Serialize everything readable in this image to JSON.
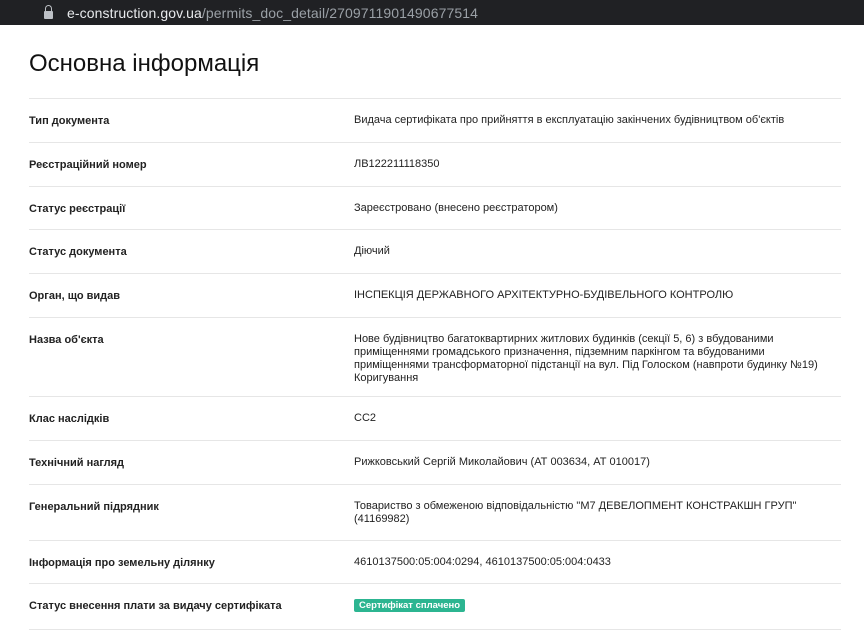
{
  "browser": {
    "url_host": "e-construction.gov.ua",
    "url_path": "/permits_doc_detail/2709711901490677514"
  },
  "page": {
    "title": "Основна інформація",
    "rows": [
      {
        "label": "Тип документа",
        "value": "Видача сертифіката про прийняття в експлуатацію закінчених будівництвом об'єктів"
      },
      {
        "label": "Реєстраційний номер",
        "value": "ЛВ122211118350"
      },
      {
        "label": "Статус реєстрації",
        "value": "Зареєстровано (внесено реєстратором)"
      },
      {
        "label": "Статус документа",
        "value": "Діючий"
      },
      {
        "label": "Орган, що видав",
        "value": "ІНСПЕКЦІЯ ДЕРЖАВНОГО АРХІТЕКТУРНО-БУДІВЕЛЬНОГО КОНТРОЛЮ"
      },
      {
        "label": "Назва об'єкта",
        "value": "Нове будівництво багатоквартирних житлових будинків (секції 5, 6) з вбудованими приміщеннями громадського призначення, підземним паркінгом та вбудованими приміщеннями трансформаторної підстанції на вул. Під Голоском (навпроти будинку №19) Коригування"
      },
      {
        "label": "Клас наслідків",
        "value": "СС2"
      },
      {
        "label": "Технічний нагляд",
        "value": "Рижковський Сергій Миколайович (АТ 003634, АТ 010017)"
      },
      {
        "label": "Генеральний підрядник",
        "value": "Товариство з обмеженою відповідальністю \"М7 ДЕВЕЛОПМЕНТ КОНСТРАКШН ГРУП\" (41169982)"
      },
      {
        "label": "Інформація про земельну ділянку",
        "value": "4610137500:05:004:0294, 4610137500:05:004:0433"
      },
      {
        "label": "Статус внесення плати за видачу сертифіката",
        "badge": "Сертифікат сплачено"
      }
    ]
  },
  "colors": {
    "address_bar": "#202124",
    "badge_bg": "#2cb591",
    "divider": "#e6e6e6"
  },
  "icons": {
    "lock": "lock-icon"
  }
}
